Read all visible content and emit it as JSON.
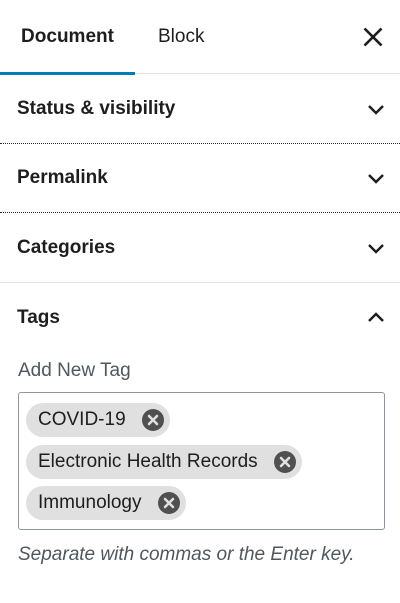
{
  "tabs": {
    "document": "Document",
    "block": "Block"
  },
  "panels": {
    "status": "Status & visibility",
    "permalink": "Permalink",
    "categories": "Categories",
    "tags": "Tags"
  },
  "tags": {
    "add_label": "Add New Tag",
    "items": [
      "COVID-19",
      "Electronic Health Records",
      "Immunology"
    ],
    "help": "Separate with commas or the Enter key."
  },
  "icons": {
    "close": "close-icon",
    "chevron_down": "chevron-down-icon",
    "chevron_up": "chevron-up-icon",
    "remove": "remove-tag-icon"
  },
  "colors": {
    "accent": "#007cba",
    "chip": "#e0e0e0",
    "chip_remove": "#505050"
  }
}
